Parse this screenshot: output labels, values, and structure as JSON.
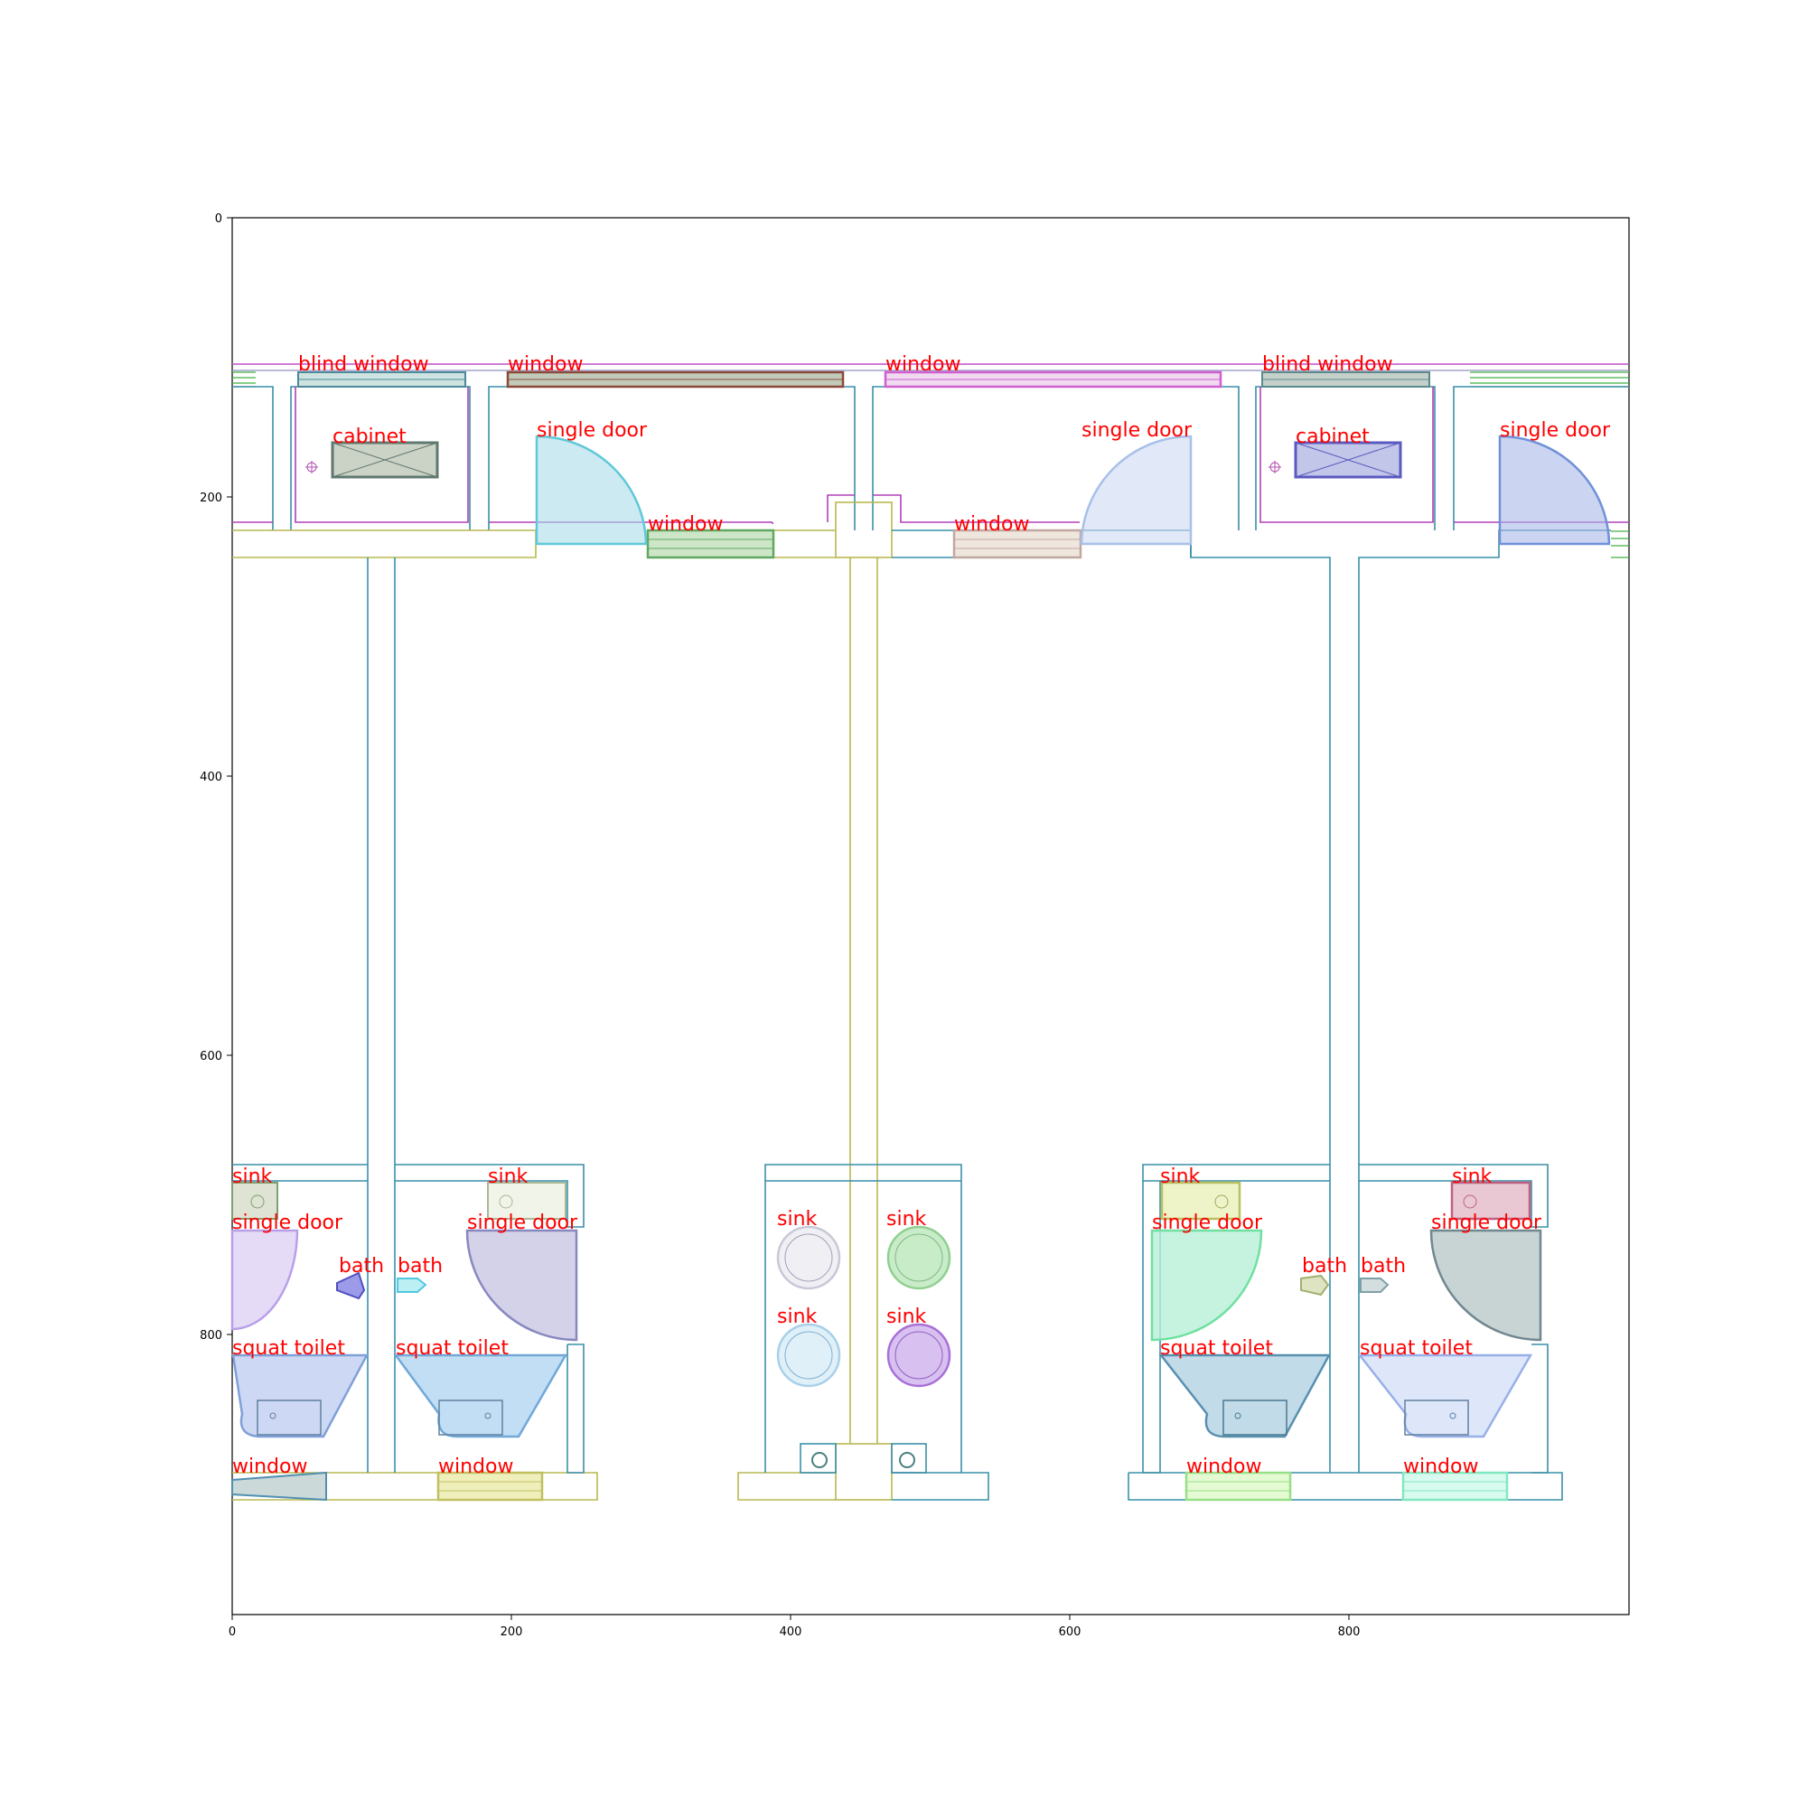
{
  "plot": {
    "x_ticks": [
      "0",
      "200",
      "400",
      "600",
      "800"
    ],
    "y_ticks": [
      "0",
      "200",
      "400",
      "600",
      "800"
    ]
  },
  "labels": [
    {
      "text": "blind window"
    },
    {
      "text": "window"
    },
    {
      "text": "window"
    },
    {
      "text": "blind window"
    },
    {
      "text": "cabinet"
    },
    {
      "text": "single door"
    },
    {
      "text": "single door"
    },
    {
      "text": "cabinet"
    },
    {
      "text": "single door"
    },
    {
      "text": "window"
    },
    {
      "text": "window"
    },
    {
      "text": "sink"
    },
    {
      "text": "sink"
    },
    {
      "text": "sink"
    },
    {
      "text": "sink"
    },
    {
      "text": "single door"
    },
    {
      "text": "single door"
    },
    {
      "text": "single door"
    },
    {
      "text": "single door"
    },
    {
      "text": "sink"
    },
    {
      "text": "sink"
    },
    {
      "text": "sink"
    },
    {
      "text": "sink"
    },
    {
      "text": "bath"
    },
    {
      "text": "bath"
    },
    {
      "text": "bath"
    },
    {
      "text": "bath"
    },
    {
      "text": "squat toilet"
    },
    {
      "text": "squat toilet"
    },
    {
      "text": "squat toilet"
    },
    {
      "text": "squat toilet"
    },
    {
      "text": "window"
    },
    {
      "text": "window"
    },
    {
      "text": "window"
    },
    {
      "text": "window"
    }
  ],
  "colors": {
    "label": "#ff0000",
    "wall_teal": "#3a8fa8",
    "wall_olive": "#b8b850",
    "wall_magenta": "#b040b8",
    "wall_green": "#40b040"
  }
}
